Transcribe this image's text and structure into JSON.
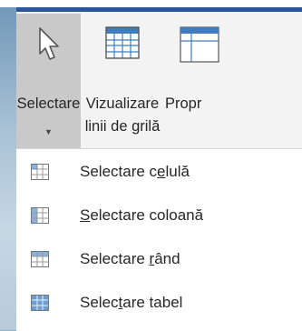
{
  "ribbon": {
    "select_button": {
      "label": "Selectare",
      "icon": "cursor-arrow-icon"
    },
    "gridlines_button": {
      "label_line1": "Vizualizare",
      "label_line2": "linii de grilă",
      "icon": "table-grid-icon"
    },
    "properties_button": {
      "label": "Propr",
      "icon": "table-properties-icon"
    }
  },
  "menu": {
    "items": [
      {
        "before": "Selectare c",
        "accel": "e",
        "after": "lulă",
        "icon": "select-cell-icon"
      },
      {
        "before": "",
        "accel": "S",
        "after": "electare coloană",
        "icon": "select-column-icon"
      },
      {
        "before": "Selectare ",
        "accel": "r",
        "after": "ând",
        "icon": "select-row-icon"
      },
      {
        "before": "Selec",
        "accel": "t",
        "after": "are tabel",
        "icon": "select-table-icon"
      }
    ]
  },
  "colors": {
    "accent": "#2b579a",
    "ribbon_bg": "#f3f3f3",
    "pressed_bg": "#c9c9c9",
    "grid_icon_blue": "#3e7dbf"
  }
}
